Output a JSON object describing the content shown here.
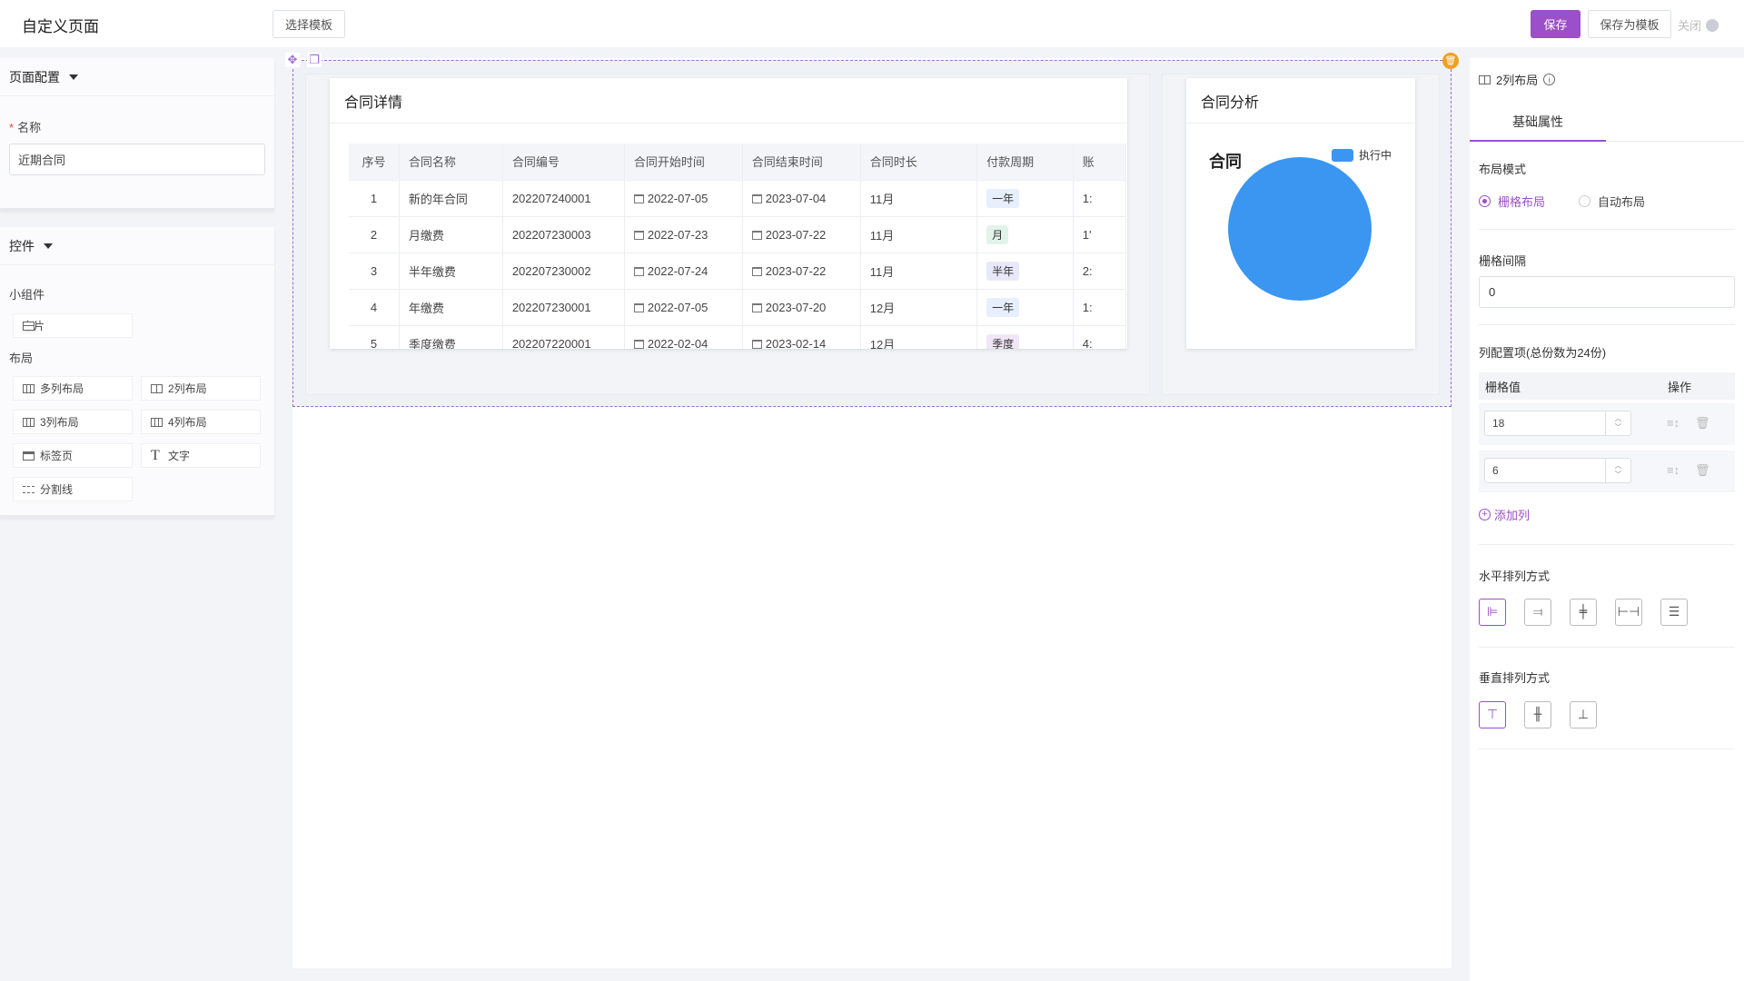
{
  "app": {
    "title": "自定义页面"
  },
  "toolbar": {
    "select_template": "选择模板",
    "save": "保存",
    "save_as_template": "保存为模板",
    "close": "关闭"
  },
  "left": {
    "page_config": {
      "title": "页面配置",
      "name_label": "名称",
      "name_value": "近期合同"
    },
    "controls": {
      "title": "控件",
      "widgets_label": "小组件",
      "widgets": [
        {
          "label": "卡片",
          "icon": "card-icon"
        }
      ],
      "layout_label": "布局",
      "layouts": [
        {
          "label": "多列布局",
          "icon": "multi-column-icon"
        },
        {
          "label": "2列布局",
          "icon": "two-column-icon"
        },
        {
          "label": "3列布局",
          "icon": "three-column-icon"
        },
        {
          "label": "4列布局",
          "icon": "four-column-icon"
        },
        {
          "label": "标签页",
          "icon": "tab-icon"
        },
        {
          "label": "文字",
          "icon": "text-icon"
        },
        {
          "label": "分割线",
          "icon": "divider-icon"
        }
      ]
    }
  },
  "canvas": {
    "contract_card": {
      "title": "合同详情",
      "columns": [
        "序号",
        "合同名称",
        "合同编号",
        "合同开始时间",
        "合同结束时间",
        "合同时长",
        "付款周期",
        "账"
      ],
      "rows": [
        {
          "no": "1",
          "name": "新的年合同",
          "code": "202207240001",
          "start": "2022-07-05",
          "end": "2023-07-04",
          "duration": "11月",
          "cycle": "一年",
          "cycle_type": "year",
          "extra": "1:"
        },
        {
          "no": "2",
          "name": "月缴费",
          "code": "202207230003",
          "start": "2022-07-23",
          "end": "2023-07-22",
          "duration": "11月",
          "cycle": "月",
          "cycle_type": "month",
          "extra": "1'"
        },
        {
          "no": "3",
          "name": "半年缴费",
          "code": "202207230002",
          "start": "2022-07-24",
          "end": "2023-07-22",
          "duration": "11月",
          "cycle": "半年",
          "cycle_type": "half",
          "extra": "2:"
        },
        {
          "no": "4",
          "name": "年缴费",
          "code": "202207230001",
          "start": "2022-07-05",
          "end": "2023-07-20",
          "duration": "12月",
          "cycle": "一年",
          "cycle_type": "year",
          "extra": "1:"
        },
        {
          "no": "5",
          "name": "季度缴费",
          "code": "202207220001",
          "start": "2022-02-04",
          "end": "2023-02-14",
          "duration": "12月",
          "cycle": "季度",
          "cycle_type": "quarter",
          "extra": "4:"
        }
      ]
    },
    "analysis_card": {
      "title": "合同分析"
    }
  },
  "chart_data": {
    "type": "pie",
    "title": "合同",
    "legend_placement": "top-right",
    "series": [
      {
        "name": "执行中",
        "values": [
          1
        ],
        "color": "#3a96f0"
      }
    ],
    "categories": [
      "执行中"
    ]
  },
  "right": {
    "component_title": "2列布局",
    "tab_basic": "基础属性",
    "layout_mode_label": "布局模式",
    "layout_modes": [
      "栅格布局",
      "自动布局"
    ],
    "layout_mode_selected": "栅格布局",
    "gutter_label": "栅格间隔",
    "gutter_value": "0",
    "col_config_label": "列配置项(总份数为24份)",
    "col_head_value": "栅格值",
    "col_head_ops": "操作",
    "col_values": [
      "18",
      "6"
    ],
    "add_col": "添加列",
    "h_align_label": "水平排列方式",
    "v_align_label": "垂直排列方式"
  },
  "colors": {
    "accent": "#9b4fc8",
    "badge": "#f0a020",
    "pie": "#3a96f0"
  }
}
